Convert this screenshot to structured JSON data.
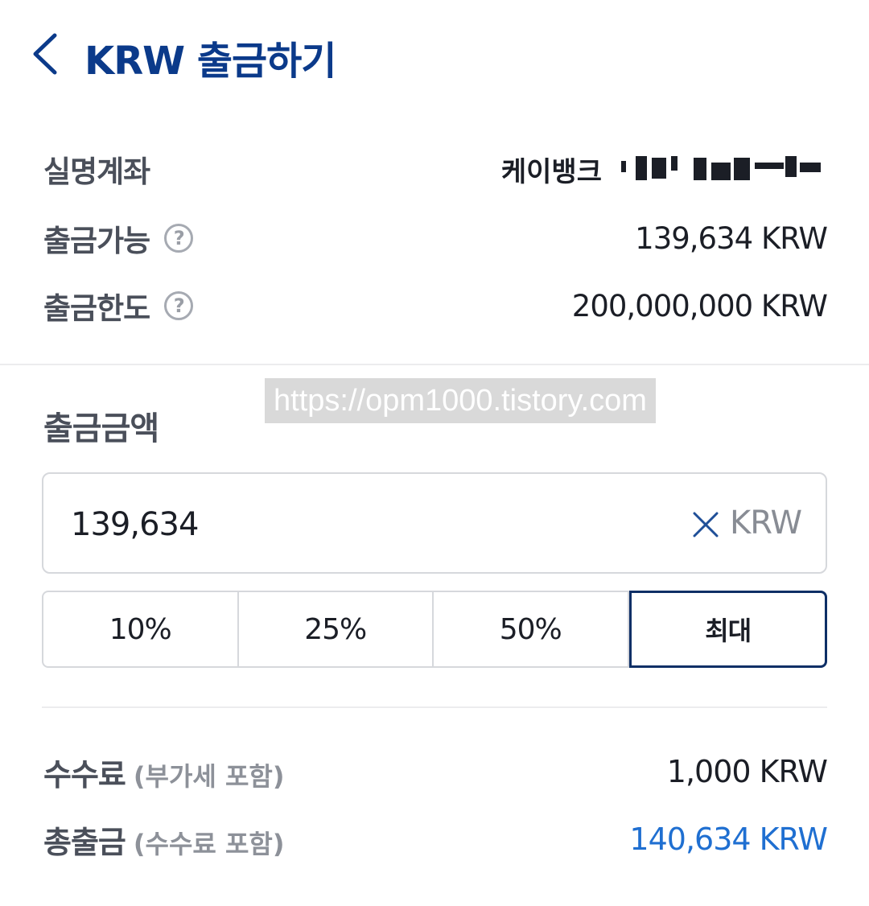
{
  "header": {
    "title": "KRW 출금하기",
    "back_icon": "chevron-left-icon"
  },
  "account": {
    "label": "실명계좌",
    "bank": "케이뱅크",
    "number_masked": true
  },
  "available": {
    "label": "출금가능",
    "value": "139,634 KRW",
    "help_icon": "?"
  },
  "limit": {
    "label": "출금한도",
    "value": "200,000,000 KRW",
    "help_icon": "?"
  },
  "watermark": "https://opm1000.tistory.com",
  "amount": {
    "label": "출금금액",
    "value": "139,634",
    "unit": "KRW"
  },
  "percent_buttons": [
    "10%",
    "25%",
    "50%",
    "최대"
  ],
  "selected_percent": "최대",
  "fee": {
    "label": "수수료",
    "sub": "(부가세 포함)",
    "value": "1,000 KRW"
  },
  "total": {
    "label": "총출금",
    "sub": "(수수료 포함)",
    "value": "140,634 KRW"
  },
  "colors": {
    "title": "#0b3a8a",
    "accent_blue": "#1f6fd1",
    "selected_border": "#0e2f66"
  }
}
